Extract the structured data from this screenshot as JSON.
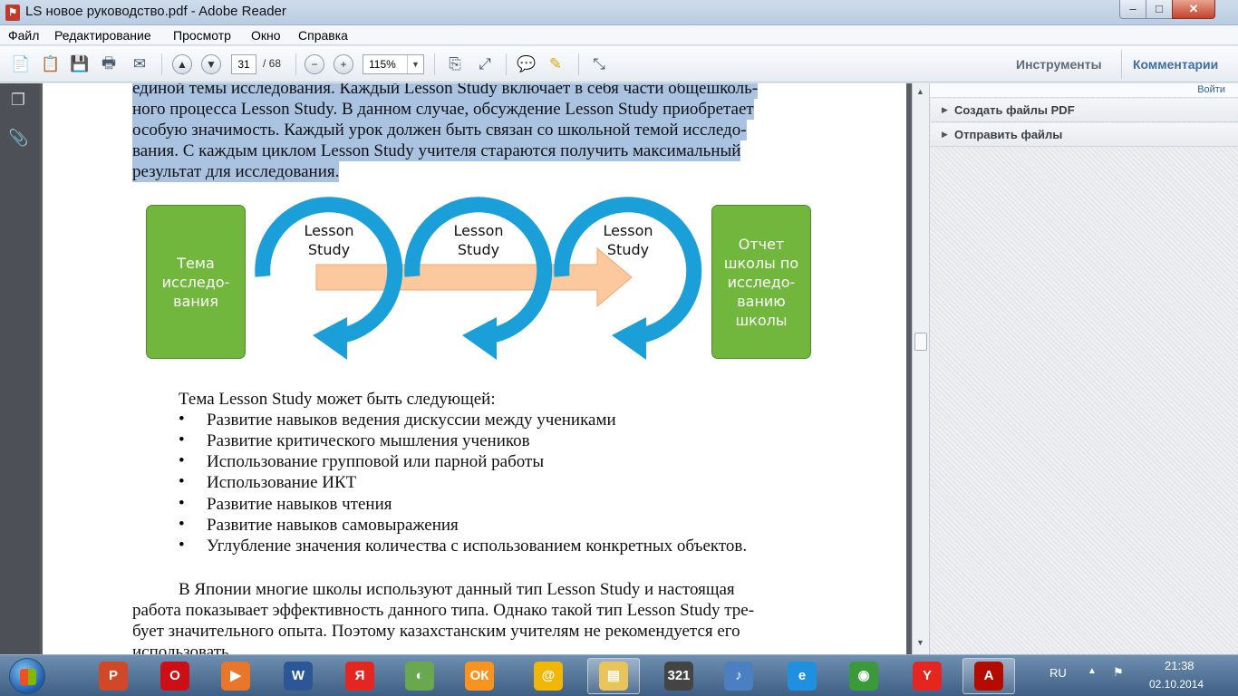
{
  "window": {
    "title": "LS новое руководство.pdf - Adobe Reader",
    "app_icon": "pdf-icon",
    "min": "–",
    "max": "□",
    "close": "✕"
  },
  "menu": [
    "Файл",
    "Редактирование",
    "Просмотр",
    "Окно",
    "Справка"
  ],
  "toolbar": {
    "page_current": "31",
    "page_total": "/ 68",
    "zoom": "115%",
    "tools": "Инструменты",
    "comments": "Комментарии"
  },
  "right_pane": {
    "signin": "Войти",
    "items": [
      "Создать файлы PDF",
      "Отправить файлы"
    ]
  },
  "document": {
    "highlighted_lines": [
      "единой темы исследования. Каждый Lesson Study включает в себя части общешколь-",
      "ного процесса Lesson Study. В данном случае, обсуждение Lesson Study приобретает",
      "особую значимость. Каждый урок должен быть связан со школьной темой исследо-",
      "вания. С каждым циклом Lesson Study учителя стараются получить максимальный",
      "результат для исследования."
    ],
    "diagram": {
      "left_box": [
        "Тема",
        "исследо-",
        "вания"
      ],
      "loop_label": [
        "Lesson",
        "Study"
      ],
      "right_box": [
        "Отчет",
        "школы по",
        "исследо-",
        "ванию",
        "школы"
      ]
    },
    "list_intro": "Тема Lesson Study может быть следующей:",
    "bullet_char": "•",
    "bullets": [
      "Развитие навыков ведения дискуссии между учениками",
      "Развитие критического мышления учеников",
      "Использование групповой или парной работы",
      "Использование ИКТ",
      "Развитие навыков чтения",
      "Развитие навыков самовыражения",
      "Углубление значения количества с использованием конкретных объектов."
    ],
    "paragraph_lines": [
      "В Японии многие школы используют данный тип Lesson Study и настоящая",
      "работа показывает эффективность данного типа. Однако такой тип Lesson Study  тре-",
      "бует значительного опыта. Поэтому казахстанским учителям не рекомендуется его",
      "использовать."
    ]
  },
  "taskbar": {
    "apps": [
      {
        "name": "powerpoint",
        "label": "P",
        "color": "#d24726"
      },
      {
        "name": "opera",
        "label": "O",
        "color": "#cc0f16"
      },
      {
        "name": "media-player",
        "label": "▶",
        "color": "#e8762b"
      },
      {
        "name": "word",
        "label": "W",
        "color": "#2b5797"
      },
      {
        "name": "yandex",
        "label": "Я",
        "color": "#e52620"
      },
      {
        "name": "app-green",
        "label": "◐",
        "color": "#6aa84f"
      },
      {
        "name": "odnoklassniki",
        "label": "ОК",
        "color": "#f7931e"
      },
      {
        "name": "mail-agent",
        "label": "@",
        "color": "#f2b705"
      },
      {
        "name": "file-explorer",
        "label": "▤",
        "color": "#e8c45a"
      },
      {
        "name": "media-classic",
        "label": "321",
        "color": "#444444"
      },
      {
        "name": "volume-app",
        "label": "♪",
        "color": "#4a7fc1"
      },
      {
        "name": "internet-explorer",
        "label": "e",
        "color": "#1f8fe0"
      },
      {
        "name": "chrome",
        "label": "◉",
        "color": "#3a9a3a"
      },
      {
        "name": "yandex-browser",
        "label": "Y",
        "color": "#e52620"
      },
      {
        "name": "adobe-reader",
        "label": "A",
        "color": "#b30b00"
      }
    ],
    "language": "RU",
    "time": "21:38",
    "date": "02.10.2014"
  }
}
